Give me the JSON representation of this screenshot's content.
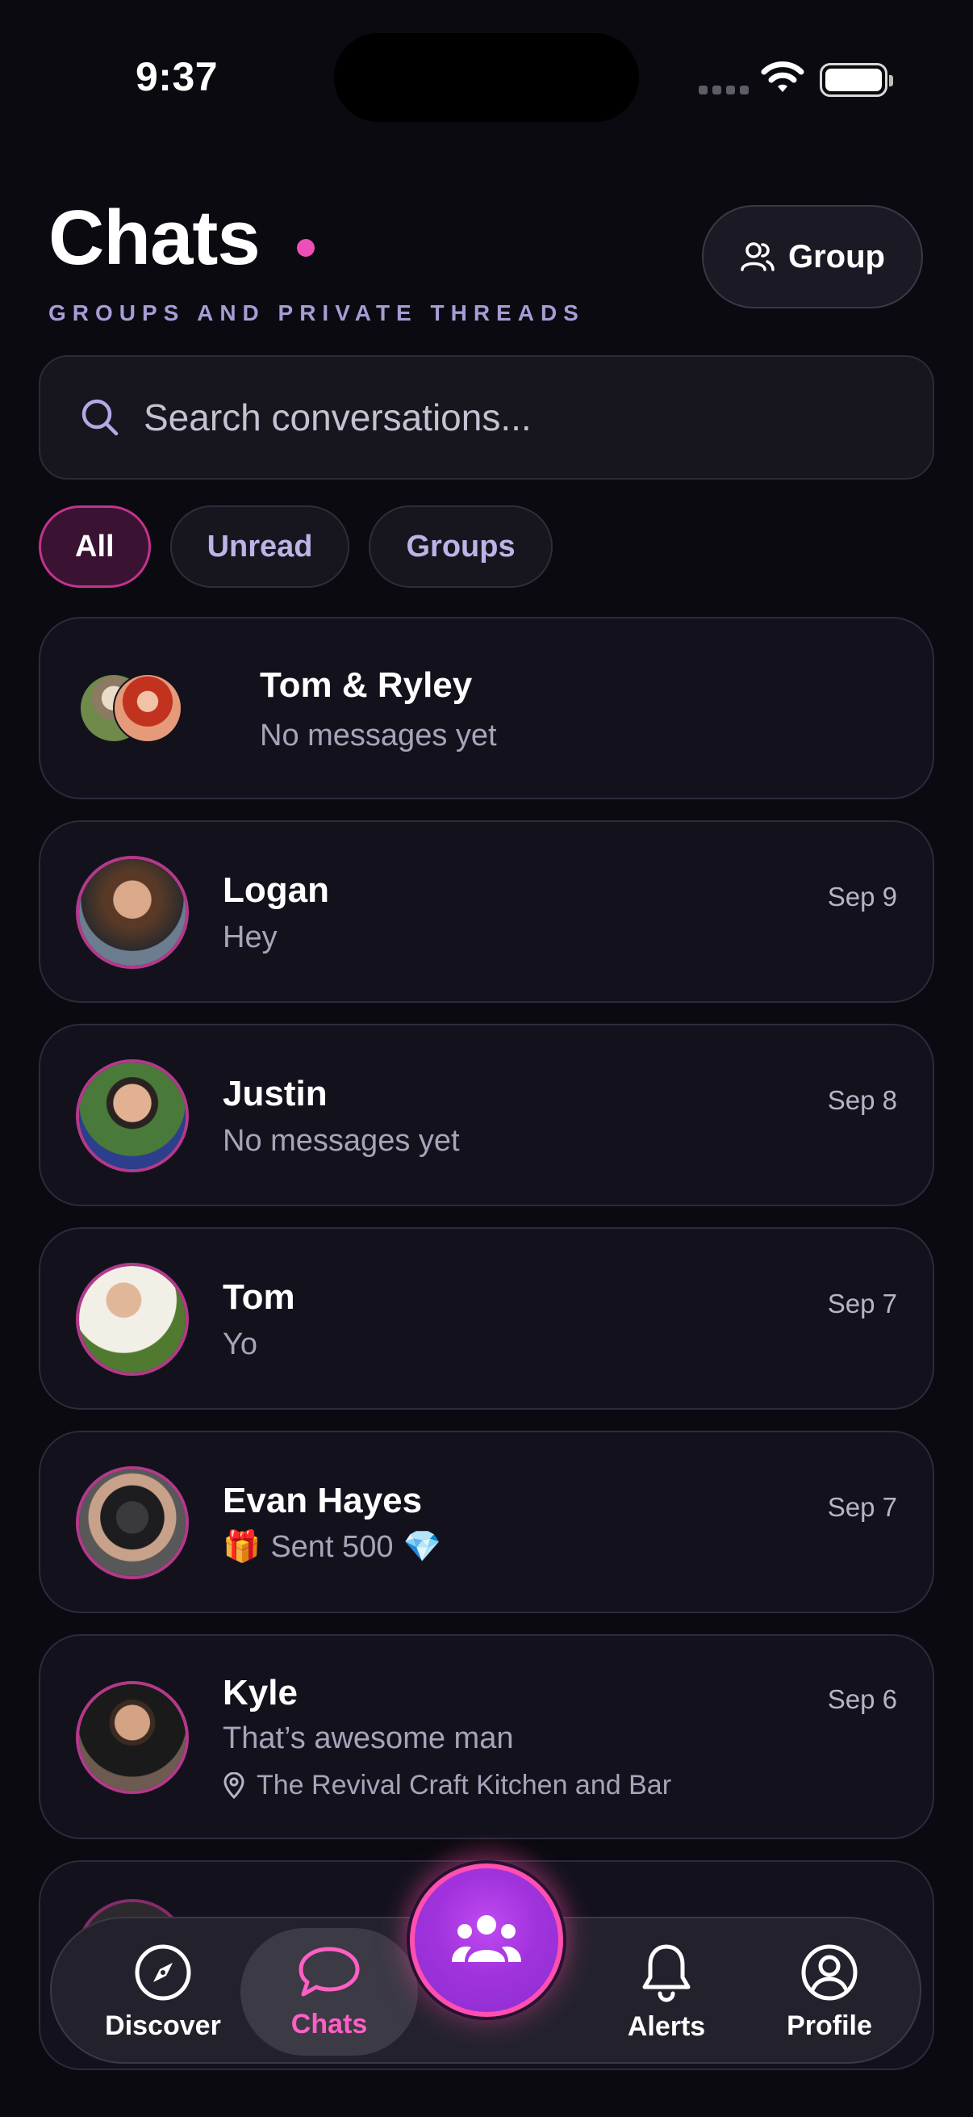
{
  "status_bar": {
    "time": "9:37"
  },
  "header": {
    "title": "Chats",
    "subtitle": "GROUPS AND PRIVATE THREADS",
    "group_button_label": "Group",
    "accent_color": "#ec4fb5"
  },
  "search": {
    "placeholder": "Search conversations..."
  },
  "filters": [
    {
      "label": "All",
      "active": true
    },
    {
      "label": "Unread",
      "active": false
    },
    {
      "label": "Groups",
      "active": false
    }
  ],
  "conversations": [
    {
      "name": "Tom & Ryley",
      "preview": "No messages yet",
      "date": "",
      "type": "group"
    },
    {
      "name": "Logan",
      "preview": "Hey",
      "date": "Sep 9"
    },
    {
      "name": "Justin",
      "preview": "No messages yet",
      "date": "Sep 8"
    },
    {
      "name": "Tom",
      "preview": "Yo",
      "date": "Sep 7"
    },
    {
      "name": "Evan Hayes",
      "preview": "Sent 500",
      "preview_prefix_emoji": "🎁",
      "preview_suffix_emoji": "💎",
      "date": "Sep 7"
    },
    {
      "name": "Kyle",
      "preview": "That’s awesome man",
      "date": "Sep 6",
      "location": "The Revival Craft Kitchen and Bar"
    }
  ],
  "bottom_nav": {
    "items": [
      {
        "label": "Discover",
        "icon": "compass-icon",
        "active": false
      },
      {
        "label": "Chats",
        "icon": "chat-bubble-icon",
        "active": true
      },
      {
        "label": "Alerts",
        "icon": "bell-icon",
        "active": false
      },
      {
        "label": "Profile",
        "icon": "user-circle-icon",
        "active": false
      }
    ],
    "center_action_icon": "people-group-icon"
  }
}
